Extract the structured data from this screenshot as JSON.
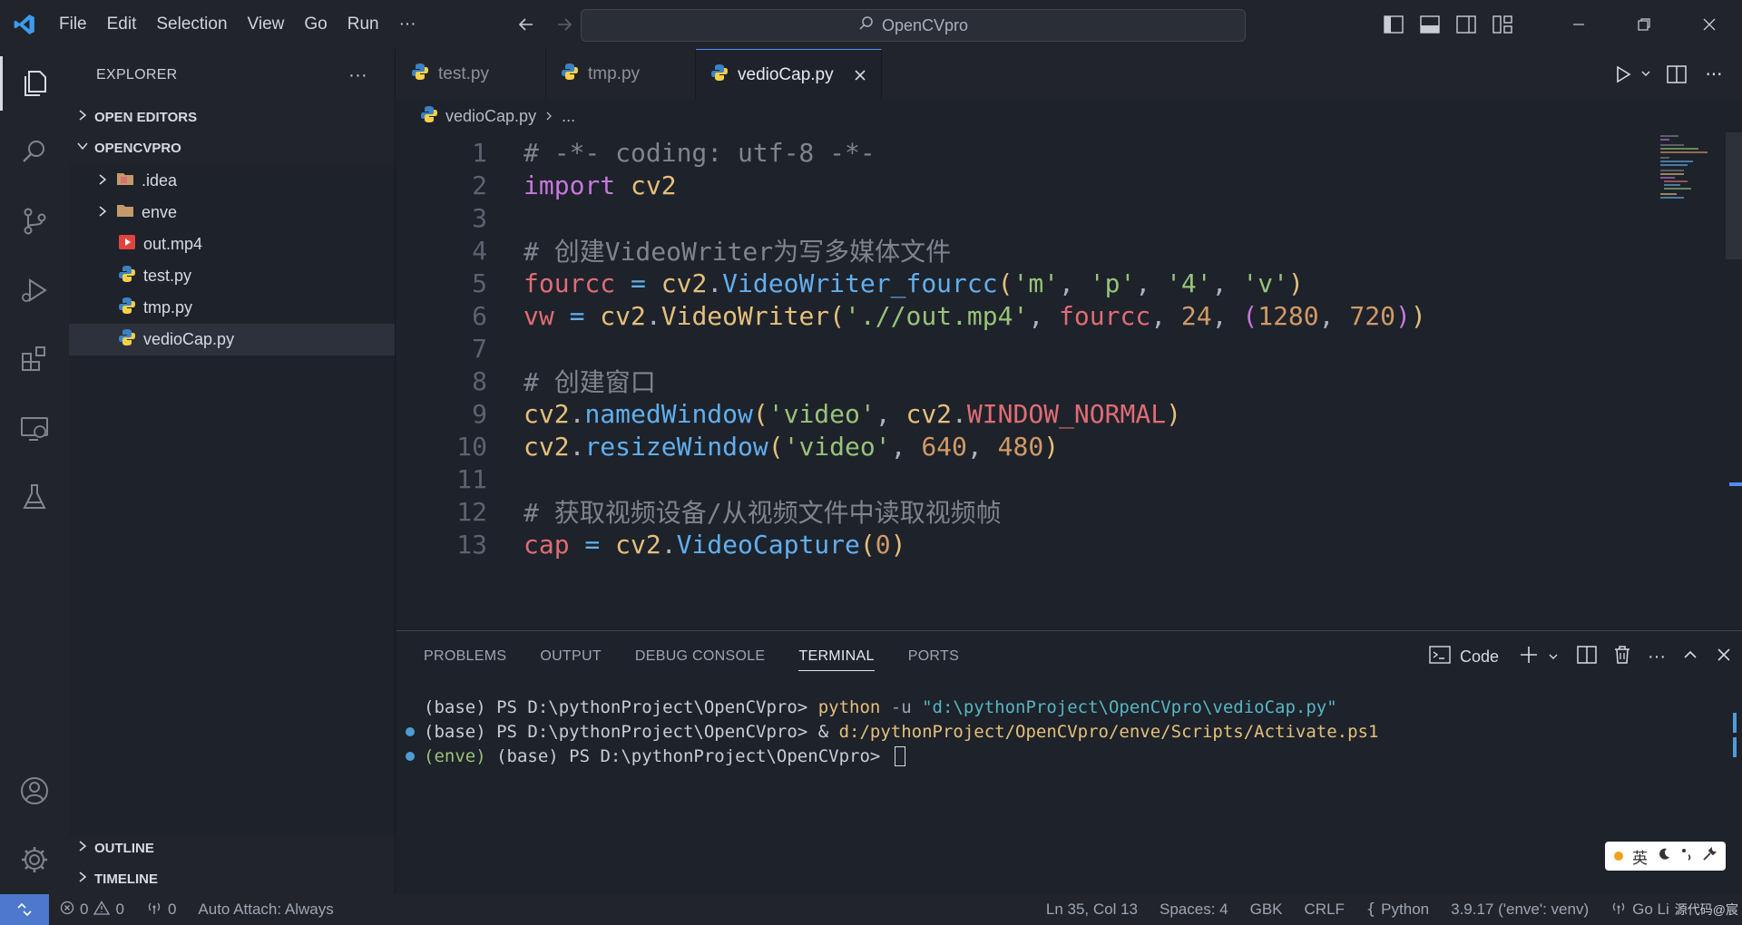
{
  "window": {
    "search_title": "OpenCVpro"
  },
  "menu": {
    "items": [
      "File",
      "Edit",
      "Selection",
      "View",
      "Go",
      "Run",
      "···"
    ]
  },
  "sidebar": {
    "header": "EXPLORER",
    "more": "···",
    "open_editors": "OPEN EDITORS",
    "project": "OPENCVPRO",
    "files": [
      {
        "name": ".idea",
        "type": "folder"
      },
      {
        "name": "enve",
        "type": "folder"
      },
      {
        "name": "out.mp4",
        "type": "video"
      },
      {
        "name": "test.py",
        "type": "python"
      },
      {
        "name": "tmp.py",
        "type": "python"
      },
      {
        "name": "vedioCap.py",
        "type": "python",
        "selected": true
      }
    ],
    "outline": "OUTLINE",
    "timeline": "TIMELINE"
  },
  "tabs": [
    {
      "label": "test.py"
    },
    {
      "label": "tmp.py"
    },
    {
      "label": "vedioCap.py",
      "active": true
    }
  ],
  "breadcrumb": {
    "file": "vedioCap.py",
    "rest": "..."
  },
  "editor": {
    "line_numbers": [
      "1",
      "2",
      "3",
      "4",
      "5",
      "6",
      "7",
      "8",
      "9",
      "10",
      "11",
      "12",
      "13"
    ],
    "lines": {
      "l1": "# -*- coding: utf-8 -*-",
      "l2_kw": "import",
      "l2_mod": " cv2",
      "l4": "# 创建VideoWriter为写多媒体文件",
      "l5_var": "fourcc",
      "l5_eq": " = ",
      "l5_mod": "cv2",
      "l5_dot": ".",
      "l5_fn": "VideoWriter_fourcc",
      "l5_p1": "(",
      "l5_s1": "'m'",
      "l5_c1": ", ",
      "l5_s2": "'p'",
      "l5_c2": ", ",
      "l5_s3": "'4'",
      "l5_c3": ", ",
      "l5_s4": "'v'",
      "l5_p2": ")",
      "l6_var": "vw",
      "l6_eq": " = ",
      "l6_mod": "cv2",
      "l6_dot": ".",
      "l6_fn": "VideoWriter",
      "l6_p1": "(",
      "l6_s1": "'.//out.mp4'",
      "l6_c1": ", ",
      "l6_arg": "fourcc",
      "l6_c2": ", ",
      "l6_n1": "24",
      "l6_c3": ", ",
      "l6_p3": "(",
      "l6_n2": "1280",
      "l6_c4": ", ",
      "l6_n3": "720",
      "l6_p4": ")",
      "l6_p2": ")",
      "l8": "# 创建窗口",
      "l9_mod": "cv2",
      "l9_dot": ".",
      "l9_fn": "namedWindow",
      "l9_p1": "(",
      "l9_s1": "'video'",
      "l9_c1": ", ",
      "l9_mod2": "cv2",
      "l9_dot2": ".",
      "l9_const": "WINDOW_NORMAL",
      "l9_p2": ")",
      "l10_mod": "cv2",
      "l10_dot": ".",
      "l10_fn": "resizeWindow",
      "l10_p1": "(",
      "l10_s1": "'video'",
      "l10_c1": ", ",
      "l10_n1": "640",
      "l10_c2": ", ",
      "l10_n2": "480",
      "l10_p2": ")",
      "l12": "# 获取视频设备/从视频文件中读取视频帧",
      "l13_var": "cap",
      "l13_eq": " = ",
      "l13_mod": "cv2",
      "l13_dot": ".",
      "l13_fn": "VideoCapture",
      "l13_p1": "(",
      "l13_n1": "0",
      "l13_p2": ")"
    }
  },
  "panel": {
    "tabs": [
      "PROBLEMS",
      "OUTPUT",
      "DEBUG CONSOLE",
      "TERMINAL",
      "PORTS"
    ],
    "active_tab": "TERMINAL",
    "terminal_name": "Code",
    "terminal": {
      "l1_prompt": "(base) PS D:\\pythonProject\\OpenCVpro> ",
      "l1_cmd": "python",
      "l1_flag": " -u ",
      "l1_str": "\"d:\\pythonProject\\OpenCVpro\\vedioCap.py\"",
      "l2_prompt": "(base) PS D:\\pythonProject\\OpenCVpro> ",
      "l2_amp": "& ",
      "l2_cmd": "d:/pythonProject/OpenCVpro/enve/Scripts/Activate.ps1",
      "l3_env": "(enve)",
      "l3_prompt": " (base) PS D:\\pythonProject\\OpenCVpro> "
    },
    "ime": {
      "lang": "英"
    }
  },
  "statusbar": {
    "errors": "0",
    "warnings": "0",
    "ports": "0",
    "auto_attach": "Auto Attach: Always",
    "position": "Ln 35, Col 13",
    "spaces": "Spaces: 4",
    "encoding": "GBK",
    "eol": "CRLF",
    "language": "Python",
    "interpreter": "3.9.17 ('enve': venv)",
    "golive": "Go Li",
    "watermark": "源代码@宸"
  },
  "colors": {
    "accent": "#528bff",
    "remote": "#4d78cc",
    "background": "#1e222a",
    "chrome": "#21252b"
  }
}
